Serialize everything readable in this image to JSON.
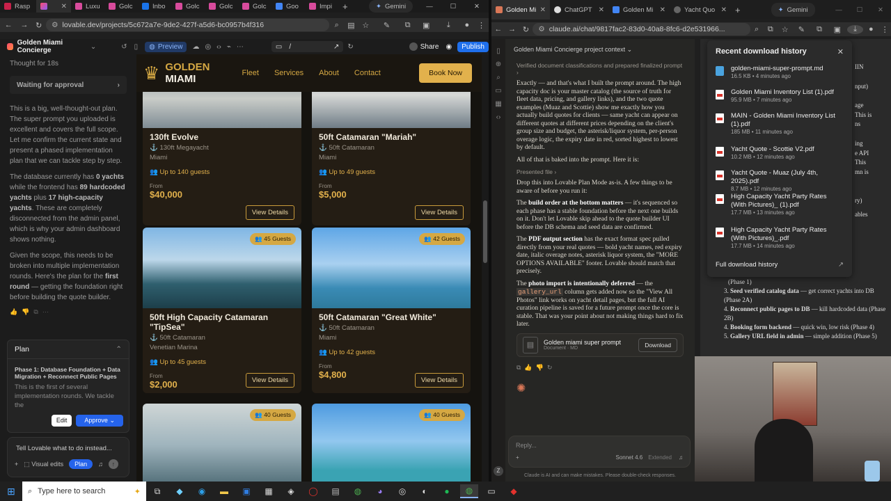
{
  "left_tabs": [
    {
      "label": "Rasp"
    },
    {
      "label": ""
    },
    {
      "label": "Luxu"
    },
    {
      "label": "Golc"
    },
    {
      "label": "Inbo"
    },
    {
      "label": "Golc"
    },
    {
      "label": "Golc"
    },
    {
      "label": "Golc"
    },
    {
      "label": "Goo"
    },
    {
      "label": "Impi"
    }
  ],
  "gemini_label": "Gemini",
  "right_tabs": [
    {
      "label": "Golden Mi"
    },
    {
      "label": "ChatGPT"
    },
    {
      "label": "Golden Mi"
    },
    {
      "label": "Yacht Quo"
    }
  ],
  "left_url": "lovable.dev/projects/5c672a7e-9de2-427f-a5d6-bc0957b4f316",
  "right_url": "claude.ai/chat/9817fac2-83d0-40a8-8fc6-d2e531966...",
  "lovable": {
    "project": "Golden Miami Concierge",
    "preview": "Preview",
    "share": "Share",
    "publish": "Publish",
    "path": "/",
    "thought": "Thought for 18s",
    "waiting": "Waiting for approval",
    "p1": "This is a big, well-thought-out plan. The super prompt you uploaded is excellent and covers the full scope. Let me confirm the current state and present a phased implementation plan that we can tackle step by step.",
    "p2a": "The database currently has ",
    "p2b": "0 yachts",
    "p2c": " while the frontend has ",
    "p2d": "89 hardcoded yachts",
    "p2e": " plus ",
    "p2f": "17 high-capacity yachts",
    "p2g": ". These are completely disconnected from the admin panel, which is why your admin dashboard shows nothing.",
    "p3a": "Given the scope, this needs to be broken into multiple implementation rounds. Here's the plan for the ",
    "p3b": "first round",
    "p3c": " — getting the foundation right before building the quote builder.",
    "plan_label": "Plan",
    "plan_title": "Phase 1: Database Foundation + Data Migration + Reconnect Public Pages",
    "plan_text": "This is the first of several implementation rounds. We tackle the",
    "edit": "Edit",
    "approve": "Approve",
    "input_placeholder": "Tell Lovable what to do instead...",
    "visual_edits": "Visual edits",
    "plan_btn": "Plan"
  },
  "site": {
    "brand_top": "GOLDEN",
    "brand_bottom": "MIAMI",
    "nav": [
      "Fleet",
      "Services",
      "About",
      "Contact"
    ],
    "book": "Book Now",
    "from": "From",
    "view": "View Details",
    "cards": [
      {
        "title": "130ft Evolve",
        "type": "130ft Megayacht",
        "loc": "Miami",
        "guests": "Up to 140 guests",
        "price": "$40,000",
        "badge": ""
      },
      {
        "title": "50ft Catamaran \"Mariah\"",
        "type": "50ft Catamaran",
        "loc": "Miami",
        "guests": "Up to 49 guests",
        "price": "$5,000",
        "badge": ""
      },
      {
        "title": "50ft High Capacity Catamaran \"TipSea\"",
        "type": "50ft Catamaran",
        "loc": "Venetian Marina",
        "guests": "Up to 45 guests",
        "price": "$2,000",
        "badge": "45 Guests"
      },
      {
        "title": "50ft Catamaran \"Great White\"",
        "type": "50ft Catamaran",
        "loc": "Miami",
        "guests": "Up to 42 guests",
        "price": "$4,800",
        "badge": "42 Guests"
      },
      {
        "badge": "40 Guests"
      },
      {
        "badge": "40 Guests"
      }
    ]
  },
  "claude": {
    "project_ctx": "Golden Miami Concierge project context",
    "verified": "Verified document classifications and prepared finalized prompt",
    "p1": "Exactly — and that's what I built the prompt around. The high capacity doc is your master catalog (the source of truth for fleet data, pricing, and gallery links), and the two quote examples (Muaz and Scottie) show me exactly how you actually build quotes for clients — same yacht can appear on different quotes at different prices depending on the client's group size and budget, the asterisk/liquor system, per-person overage logic, the expiry date in red, sorted highest to lowest by default.",
    "p2": "All of that is baked into the prompt. Here it is:",
    "presented": "Presented file",
    "p3": "Drop this into Lovable Plan Mode as-is. A few things to be aware of before you run it:",
    "p4a": "The ",
    "p4b": "build order at the bottom matters",
    "p4c": " — it's sequenced so each phase has a stable foundation before the next one builds on it. Don't let Lovable skip ahead to the quote builder UI before the DB schema and seed data are confirmed.",
    "p5a": "The ",
    "p5b": "PDF output section",
    "p5c": " has the exact format spec pulled directly from your real quotes — bold yacht names, red expiry date, italic overage notes, asterisk liquor system, the \"MORE OPTIONS AVAILABLE\" footer. Lovable should match that precisely.",
    "p6a": "The ",
    "p6b": "photo import is intentionally deferred",
    "p6c": " — the ",
    "p6code": "gallery_url",
    "p6d": " column gets added now so the \"View All Photos\" link works on yacht detail pages, but the full AI curation pipeline is saved for a future prompt once the core is stable. That was your point about not making things hard to fix later.",
    "file_name": "Golden miami super prompt",
    "file_type": "Document · MD",
    "download": "Download",
    "reply": "Reply...",
    "model": "Sonnet 4.6",
    "extended": "Extended",
    "disclaimer": "Claude is AI and can make mistakes. Please double-check responses."
  },
  "downloads": {
    "title": "Recent download history",
    "items": [
      {
        "name": "golden-miami-super-prompt.md",
        "meta": "16.5 KB • 4 minutes ago"
      },
      {
        "name": "Golden Miami Inventory List (1).pdf",
        "meta": "95.9 MB • 7 minutes ago"
      },
      {
        "name": "MAIN - Golden Miami Inventory List (1).pdf",
        "meta": "185 MB • 11 minutes ago"
      },
      {
        "name": "Yacht Quote - Scottie V2.pdf",
        "meta": "10.2 MB • 12 minutes ago"
      },
      {
        "name": "Yacht Quote - Muaz (July 4th, 2025).pdf",
        "meta": "8.7 MB • 12 minutes ago"
      },
      {
        "name": "High Capacity Yacht Party Rates (With Pictures)_ (1).pdf",
        "meta": "17.7 MB • 13 minutes ago"
      },
      {
        "name": "High Capacity Yacht Party Rates (With Pictures)_.pdf",
        "meta": "17.7 MB • 14 minutes ago"
      }
    ],
    "full": "Full download history"
  },
  "side_doc": {
    "lines": [
      "IIN",
      "nput)",
      "age",
      "This is",
      "ns",
      "ing",
      "e API",
      "This",
      "mn is",
      "ry)",
      "ables"
    ],
    "l1": "(Phase 1)",
    "l2b": "Seed verified catalog data",
    "l2": " — get correct yachts into DB (Phase 2A)",
    "l3b": "Reconnect public pages to DB",
    "l3": " — kill hardcoded data (Phase 2B)",
    "l4b": "Booking form backend",
    "l4": " — quick win, low risk (Phase 4)",
    "l5b": "Gallery URL field in admin",
    "l5": " — simple addition (Phase 5)"
  },
  "taskbar": {
    "search": "Type here to search"
  }
}
